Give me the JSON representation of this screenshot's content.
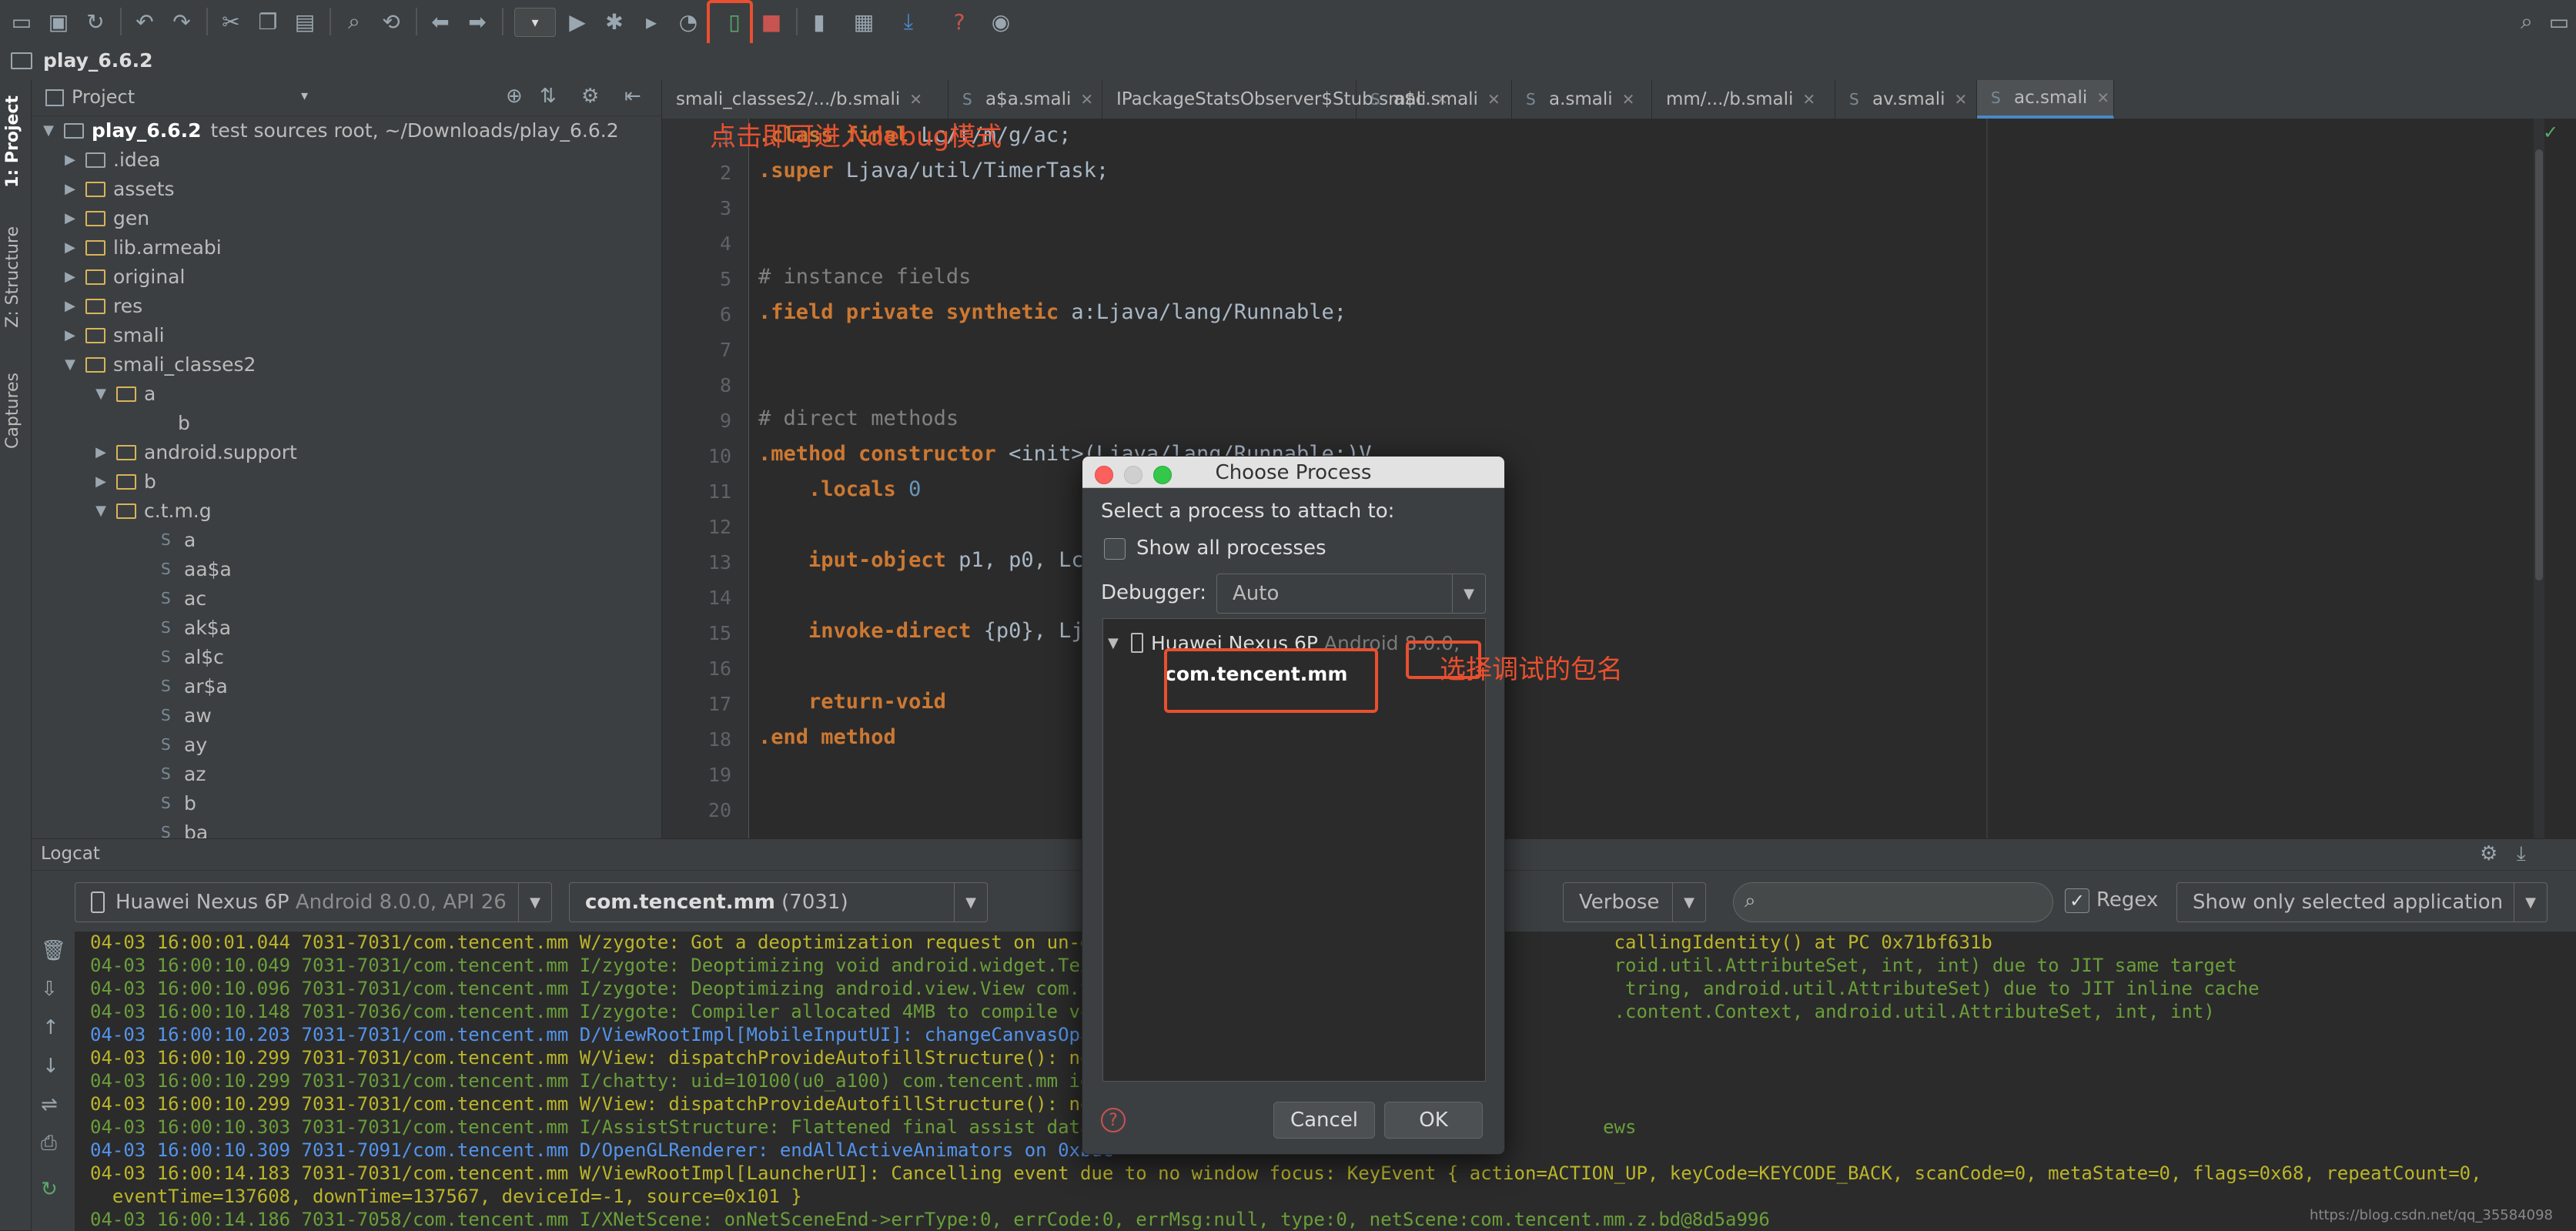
{
  "toolbar": {
    "icons": [
      "open-icon",
      "save-icon",
      "sync-icon",
      "undo-icon",
      "redo-icon",
      "cut-icon",
      "copy-icon",
      "paste-icon",
      "find-icon",
      "replace-icon",
      "back-icon",
      "forward-icon",
      "run-config-dropdown",
      "run-icon",
      "debug-icon",
      "profile-icon",
      "coverage-icon",
      "attach-debugger-icon",
      "stop-icon",
      "sdk-manager-icon",
      "avd-manager-icon",
      "apk-analyzer-icon",
      "help-icon",
      "search-everywhere-icon"
    ]
  },
  "navbar": {
    "breadcrumb": "play_6.6.2"
  },
  "side_tabs": {
    "project": "1: Project",
    "structure": "Z: Structure",
    "captures": "Captures"
  },
  "project_panel": {
    "title": "Project",
    "root": {
      "name": "play_6.6.2",
      "detail": "test sources root,  ~/Downloads/play_6.6.2"
    },
    "items": [
      {
        "label": ".idea",
        "kind": "folder"
      },
      {
        "label": "assets",
        "kind": "folder"
      },
      {
        "label": "gen",
        "kind": "folder"
      },
      {
        "label": "lib.armeabi",
        "kind": "folder"
      },
      {
        "label": "original",
        "kind": "folder"
      },
      {
        "label": "res",
        "kind": "folder"
      },
      {
        "label": "smali",
        "kind": "folder"
      },
      {
        "label": "smali_classes2",
        "kind": "folder"
      },
      {
        "label": "a",
        "kind": "folder"
      },
      {
        "label": "b",
        "kind": "file"
      },
      {
        "label": "android.support",
        "kind": "folder"
      },
      {
        "label": "b",
        "kind": "folder"
      },
      {
        "label": "c.t.m.g",
        "kind": "folder"
      },
      {
        "label": "a",
        "kind": "file"
      },
      {
        "label": "aa$a",
        "kind": "file"
      },
      {
        "label": "ac",
        "kind": "file"
      },
      {
        "label": "ak$a",
        "kind": "file"
      },
      {
        "label": "al$c",
        "kind": "file"
      },
      {
        "label": "ar$a",
        "kind": "file"
      },
      {
        "label": "aw",
        "kind": "file"
      },
      {
        "label": "ay",
        "kind": "file"
      },
      {
        "label": "az",
        "kind": "file"
      },
      {
        "label": "b",
        "kind": "file"
      },
      {
        "label": "ba",
        "kind": "file"
      }
    ]
  },
  "editor": {
    "tabs": [
      {
        "label": "smali_classes2/.../b.smali"
      },
      {
        "label": "a$a.smali"
      },
      {
        "label": "IPackageStatsObserver$Stub.smali"
      },
      {
        "label": "a$c.smali"
      },
      {
        "label": "a.smali"
      },
      {
        "label": "mm/.../b.smali"
      },
      {
        "label": "av.smali"
      },
      {
        "label": "ac.smali",
        "active": true
      }
    ],
    "line_numbers": [
      "1",
      "2",
      "3",
      "4",
      "5",
      "6",
      "7",
      "8",
      "9",
      "10",
      "11",
      "12",
      "13",
      "14",
      "15",
      "16",
      "17",
      "18",
      "19",
      "20"
    ],
    "code": {
      "l1_kw": ".class final ",
      "l1_rest": "Lc/t/m/g/ac;",
      "l2_kw": ".super ",
      "l2_rest": "Ljava/util/TimerTask;",
      "l5": "# instance fields",
      "l6_kw": ".field private synthetic ",
      "l6_rest": "a:Ljava/lang/Runnable;",
      "l9": "# direct methods",
      "l10_kw": ".method constructor ",
      "l10_rest": "<init>(Ljava/lang/Runnable;)V",
      "l11_kw": "    .locals ",
      "l11_num": "0",
      "l13_kw": "    iput-object ",
      "l13_rest": "p1, p0, Lc/",
      "l15_kw": "    invoke-direct ",
      "l15_rest": "{p0}, Lja",
      "l17_kw": "    return-void",
      "l18_kw": ".end method"
    }
  },
  "logcat": {
    "title": "Logcat",
    "device": "Huawei Nexus 6P",
    "device_detail": "Android 8.0.0, API 26",
    "process": "com.tencent.mm",
    "process_detail": "(7031)",
    "level": "Verbose",
    "search_placeholder": "",
    "regex_label": "Regex",
    "filter": "Show only selected application",
    "lines": [
      {
        "level": "w",
        "text": "04-03 16:00:01.044 7031-7031/com.tencent.mm W/zygote: Got a deoptimization request on un-dep                                             callingIdentity() at PC 0x71bf631b"
      },
      {
        "level": "i",
        "text": "04-03 16:00:10.049 7031-7031/com.tencent.mm I/zygote: Deoptimizing void android.widget.TextV                                             roid.util.AttributeSet, int, int) due to JIT same target"
      },
      {
        "level": "i",
        "text": "04-03 16:00:10.096 7031-7031/com.tencent.mm I/zygote: Deoptimizing android.view.View com.ten                                              tring, android.util.AttributeSet) due to JIT inline cache"
      },
      {
        "level": "i",
        "text": "04-03 16:00:10.148 7031-7036/com.tencent.mm I/zygote: Compiler allocated 4MB to compile void                                             .content.Context, android.util.AttributeSet, int, int)"
      },
      {
        "level": "d",
        "text": "04-03 16:00:10.203 7031-7031/com.tencent.mm D/ViewRootImpl[MobileInputUI]: changeCanvasOpaci"
      },
      {
        "level": "w",
        "text": "04-03 16:00:10.299 7031-7031/com.tencent.mm W/View: dispatchProvideAutofillStructure(): not"
      },
      {
        "level": "i",
        "text": "04-03 16:00:10.299 7031-7031/com.tencent.mm I/chatty: uid=10100(u0_a100) com.tencent.mm iden"
      },
      {
        "level": "w",
        "text": "04-03 16:00:10.299 7031-7031/com.tencent.mm W/View: dispatchProvideAutofillStructure(): not"
      },
      {
        "level": "i",
        "text": "04-03 16:00:10.303 7031-7031/com.tencent.mm I/AssistStructure: Flattened final assist data:                                             ews"
      },
      {
        "level": "d",
        "text": "04-03 16:00:10.309 7031-7091/com.tencent.mm D/OpenGLRenderer: endAllActiveAnimators on 0xbdc"
      },
      {
        "level": "w",
        "text": "04-03 16:00:14.183 7031-7031/com.tencent.mm W/ViewRootImpl[LauncherUI]: Cancelling event due to no window focus: KeyEvent { action=ACTION_UP, keyCode=KEYCODE_BACK, scanCode=0, metaState=0, flags=0x68, repeatCount=0,"
      },
      {
        "level": "w",
        "text": "  eventTime=137608, downTime=137567, deviceId=-1, source=0x101 }"
      },
      {
        "level": "i",
        "text": "04-03 16:00:14.186 7031-7058/com.tencent.mm I/XNetScene: onNetSceneEnd->errType:0, errCode:0, errMsg:null, type:0, netScene:com.tencent.mm.z.bd@8d5a996"
      }
    ]
  },
  "dialog": {
    "title": "Choose Process",
    "prompt": "Select a process to attach to:",
    "show_all": "Show all processes",
    "show_all_checked": false,
    "debugger_label": "Debugger:",
    "debugger_value": "Auto",
    "device_name": "Huawei Nexus 6P",
    "device_detail": "Android 8.0.0,",
    "process_item": "com.tencent.mm",
    "cancel": "Cancel",
    "ok": "OK"
  },
  "annotations": {
    "debug_hint": "点击即可进入debug模式",
    "package_hint": "选择调试的包名",
    "color": "#e8502f"
  },
  "watermark": "https://blog.csdn.net/qq_35584098"
}
